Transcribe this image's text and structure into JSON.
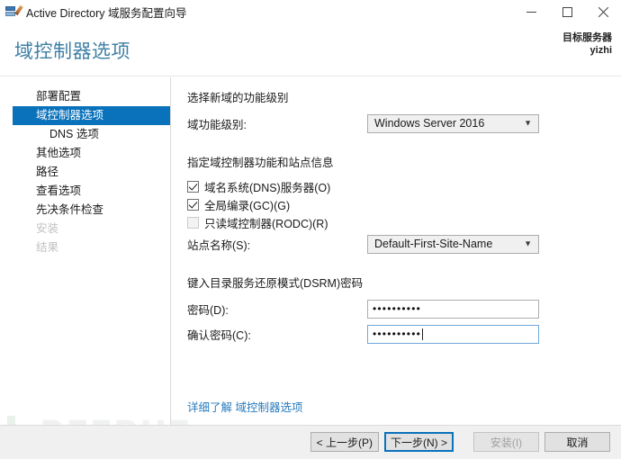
{
  "window": {
    "title": "Active Directory 域服务配置向导",
    "icon": "ad-server-icon",
    "controls": {
      "minimize": "minimize-icon",
      "maximize": "maximize-icon",
      "close": "close-icon"
    }
  },
  "header": {
    "title": "域控制器选项",
    "target_label": "目标服务器",
    "target_server": "yizhi",
    "accent_color": "#3f7fa5"
  },
  "sidebar": {
    "items": [
      {
        "label": "部署配置",
        "state": "normal",
        "indent": false
      },
      {
        "label": "域控制器选项",
        "state": "selected",
        "indent": false
      },
      {
        "label": "DNS 选项",
        "state": "normal",
        "indent": true
      },
      {
        "label": "其他选项",
        "state": "normal",
        "indent": false
      },
      {
        "label": "路径",
        "state": "normal",
        "indent": false
      },
      {
        "label": "查看选项",
        "state": "normal",
        "indent": false
      },
      {
        "label": "先决条件检查",
        "state": "normal",
        "indent": false
      },
      {
        "label": "安装",
        "state": "disabled",
        "indent": false
      },
      {
        "label": "结果",
        "state": "disabled",
        "indent": false
      }
    ],
    "selected_color": "#0a72bb"
  },
  "main": {
    "functional_level_section": {
      "heading": "选择新域的功能级别",
      "field_label": "域功能级别:",
      "value": "Windows Server 2016"
    },
    "capabilities_section": {
      "heading": "指定域控制器功能和站点信息",
      "checkboxes": [
        {
          "label": "域名系统(DNS)服务器(O)",
          "checked": true,
          "disabled": false
        },
        {
          "label": "全局编录(GC)(G)",
          "checked": true,
          "disabled": false
        },
        {
          "label": "只读域控制器(RODC)(R)",
          "checked": false,
          "disabled": true
        }
      ],
      "site_label": "站点名称(S):",
      "site_value": "Default-First-Site-Name"
    },
    "dsrm_section": {
      "heading": "键入目录服务还原模式(DSRM)密码",
      "password_label": "密码(D):",
      "password_value": "••••••••••",
      "confirm_label": "确认密码(C):",
      "confirm_value": "••••••••••",
      "focused_field": "confirm"
    },
    "learn_more_link": "详细了解 域控制器选项"
  },
  "watermark": {
    "text": "REEBUF"
  },
  "footer": {
    "back_button": "< 上一步(P)",
    "next_button": "下一步(N) >",
    "install_button": "安装(I)",
    "cancel_button": "取消"
  }
}
